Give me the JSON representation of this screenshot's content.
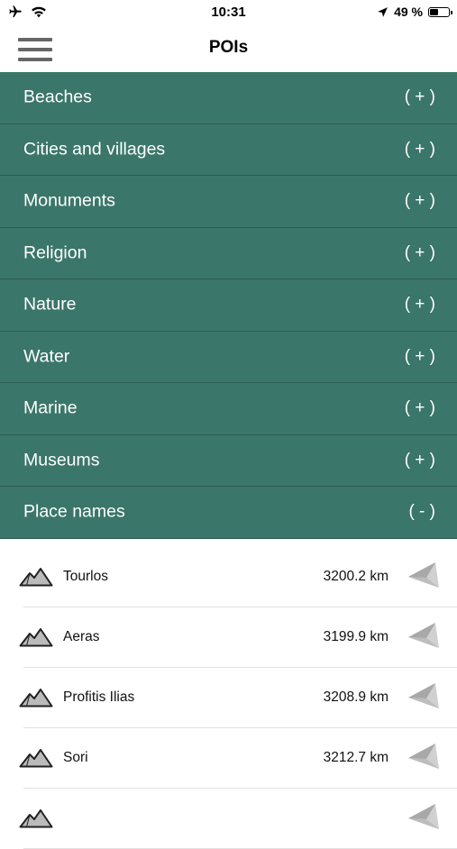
{
  "status_bar": {
    "time": "10:31",
    "battery": "49 %",
    "battery_level": 0.49,
    "icons": [
      "airplane-icon",
      "wifi-icon",
      "location-arrow-icon",
      "battery-icon"
    ]
  },
  "nav": {
    "title": "POIs",
    "menu_icon": "hamburger-menu-icon"
  },
  "colors": {
    "category_bg": "#3b766a",
    "category_text": "#ffffff"
  },
  "categories": [
    {
      "label": "Beaches",
      "toggle": "( + )"
    },
    {
      "label": "Cities and villages",
      "toggle": "( + )"
    },
    {
      "label": "Monuments",
      "toggle": "( + )"
    },
    {
      "label": "Religion",
      "toggle": "( + )"
    },
    {
      "label": "Nature",
      "toggle": "( + )"
    },
    {
      "label": "Water",
      "toggle": "( + )"
    },
    {
      "label": "Marine",
      "toggle": "( + )"
    },
    {
      "label": "Museums",
      "toggle": "( + )"
    },
    {
      "label": "Place names",
      "toggle": "( - )"
    }
  ],
  "places": [
    {
      "name": "Tourlos",
      "distance": "3200.2 km",
      "icon": "mountain-icon"
    },
    {
      "name": "Aeras",
      "distance": "3199.9 km",
      "icon": "mountain-icon"
    },
    {
      "name": "Profitis Ilias",
      "distance": "3208.9 km",
      "icon": "mountain-icon"
    },
    {
      "name": "Sori",
      "distance": "3212.7 km",
      "icon": "mountain-icon"
    },
    {
      "name": "",
      "distance": "",
      "icon": "mountain-icon"
    }
  ]
}
